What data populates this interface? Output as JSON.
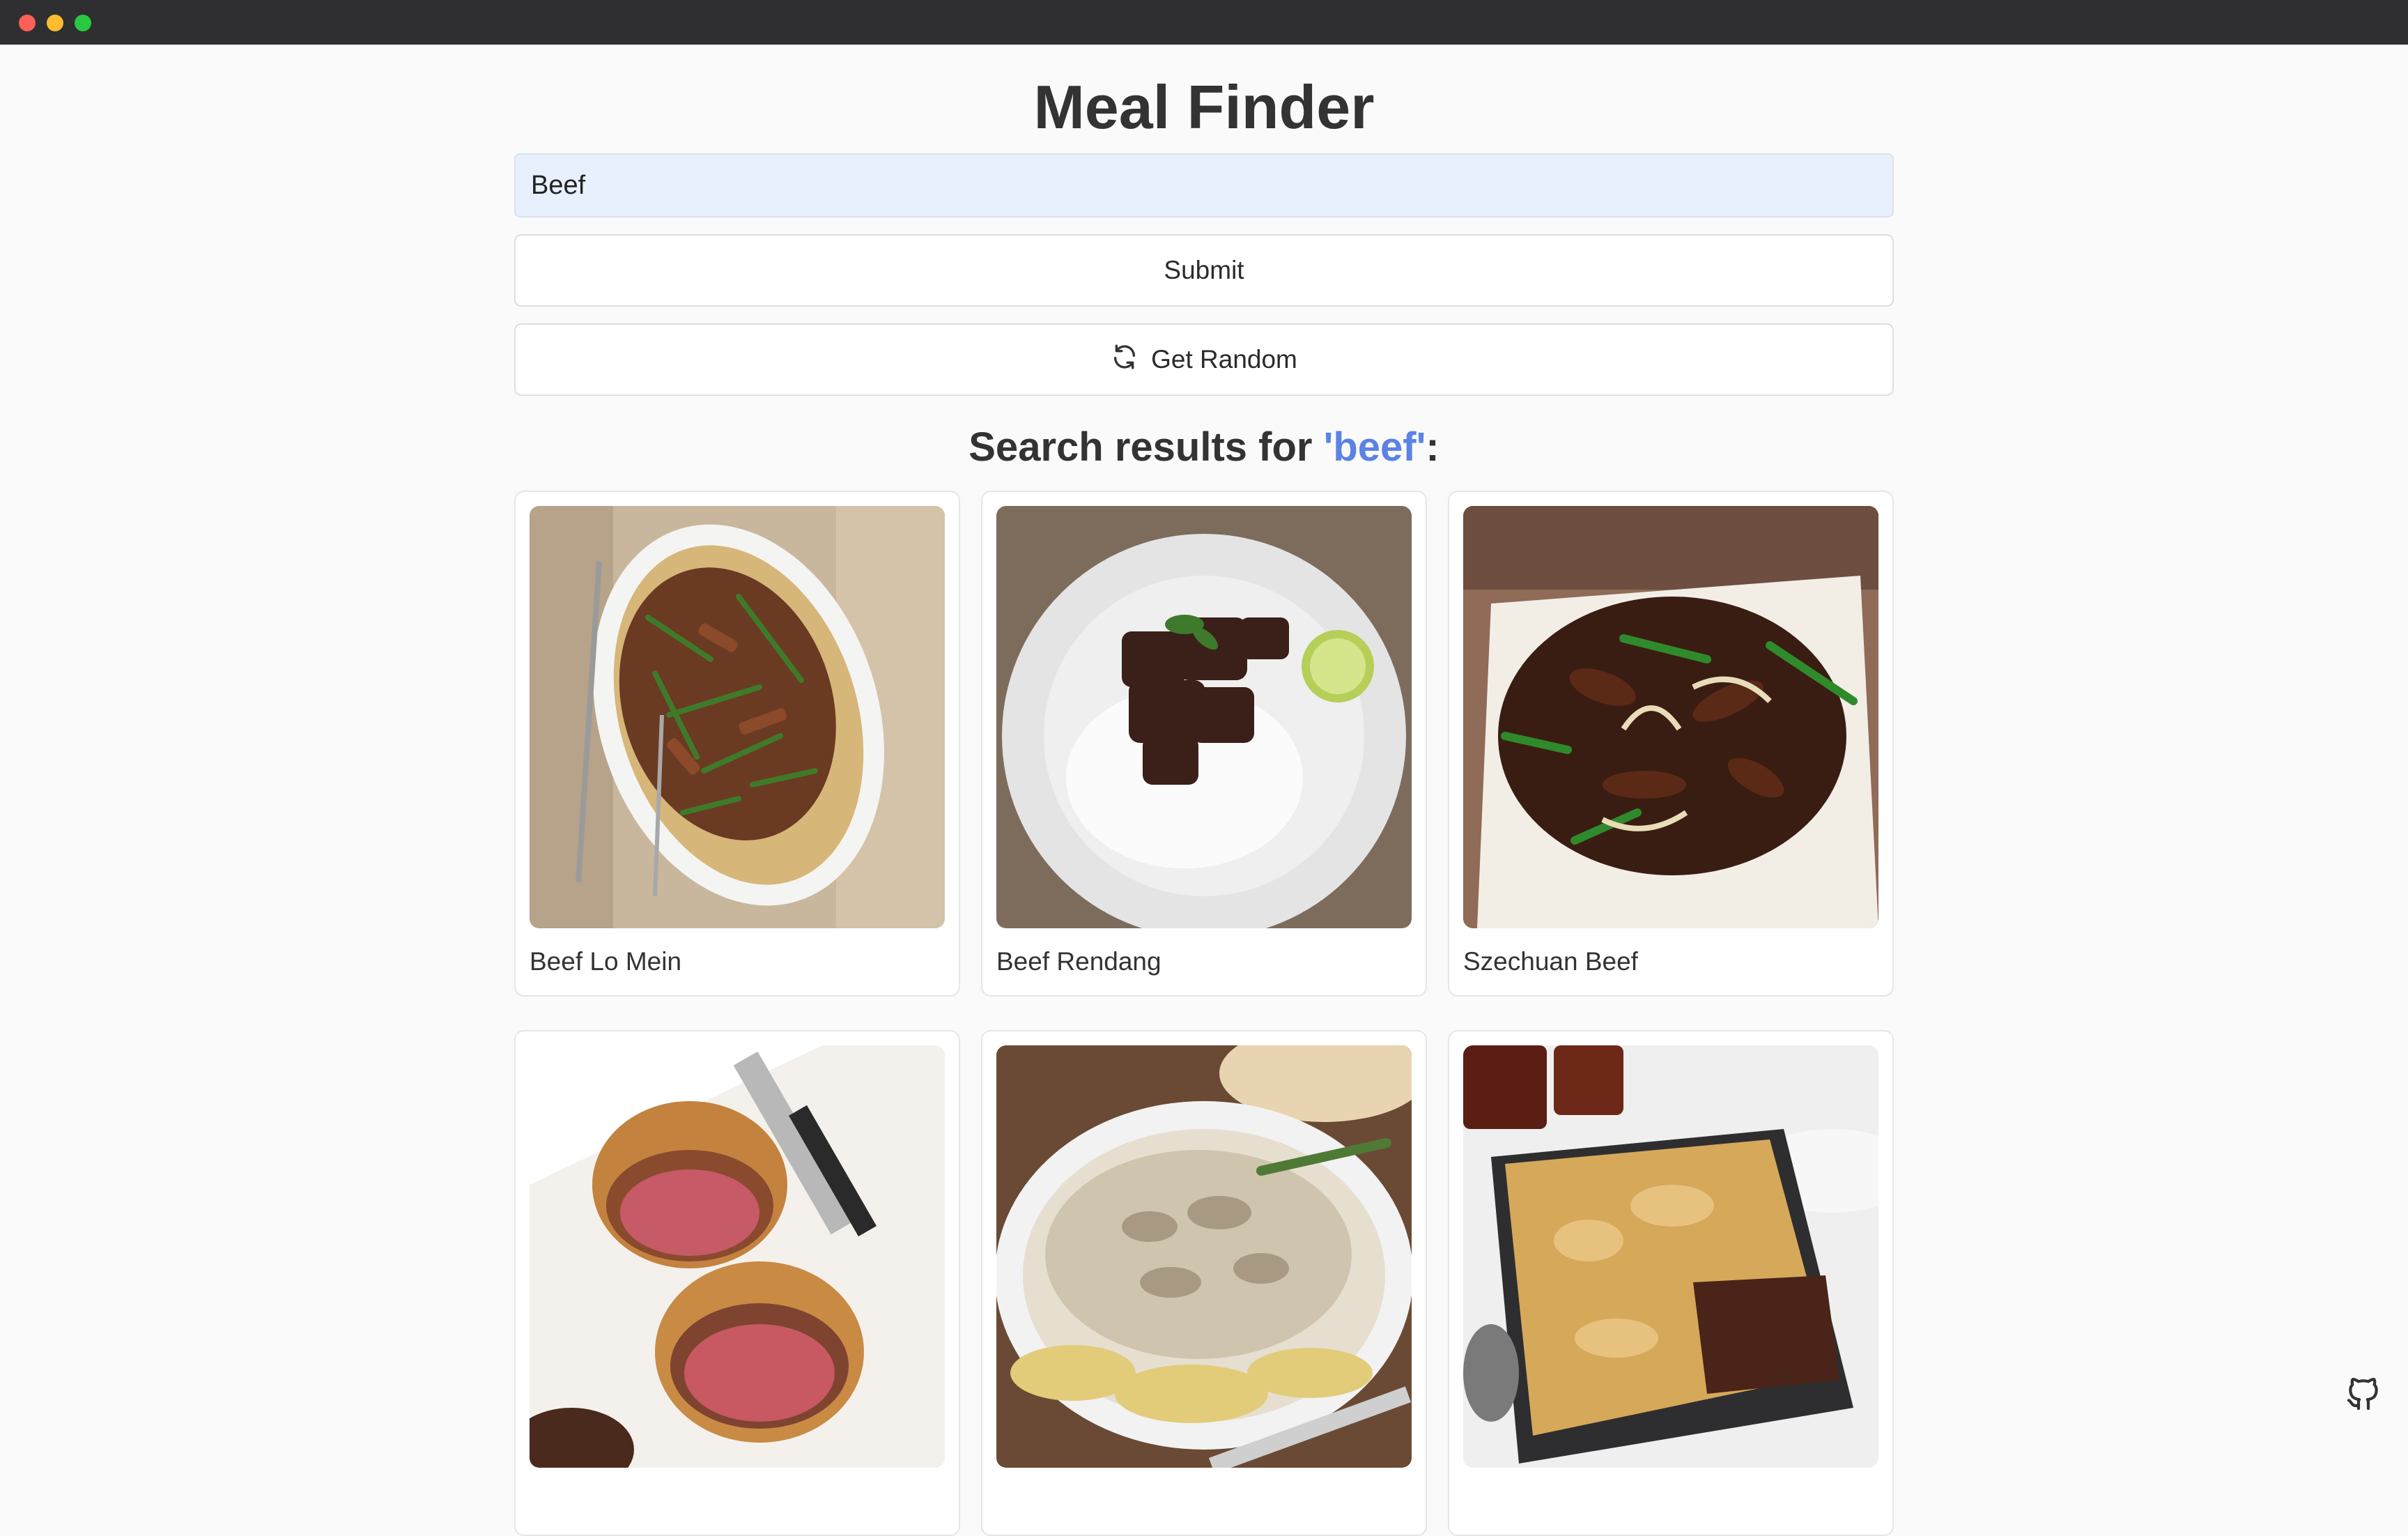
{
  "app": {
    "title": "Meal Finder"
  },
  "search": {
    "value": "Beef"
  },
  "buttons": {
    "submit_label": "Submit",
    "random_label": "Get Random"
  },
  "results": {
    "prefix": "Search results for ",
    "query": "'beef'",
    "suffix": ":",
    "meals": [
      {
        "name": "Beef Lo Mein",
        "image": "beef-lo-mein-photo"
      },
      {
        "name": "Beef Rendang",
        "image": "beef-rendang-photo"
      },
      {
        "name": "Szechuan Beef",
        "image": "szechuan-beef-photo"
      },
      {
        "name": "",
        "image": "beef-wellington-photo"
      },
      {
        "name": "",
        "image": "beef-stroganoff-photo"
      },
      {
        "name": "",
        "image": "beef-pie-photo"
      }
    ]
  },
  "colors": {
    "accent": "#5b82e6",
    "input_bg": "#e8f0fe",
    "page_bg": "#fafafa"
  },
  "icons": {
    "random": "refresh-icon",
    "footer": "github-icon"
  }
}
